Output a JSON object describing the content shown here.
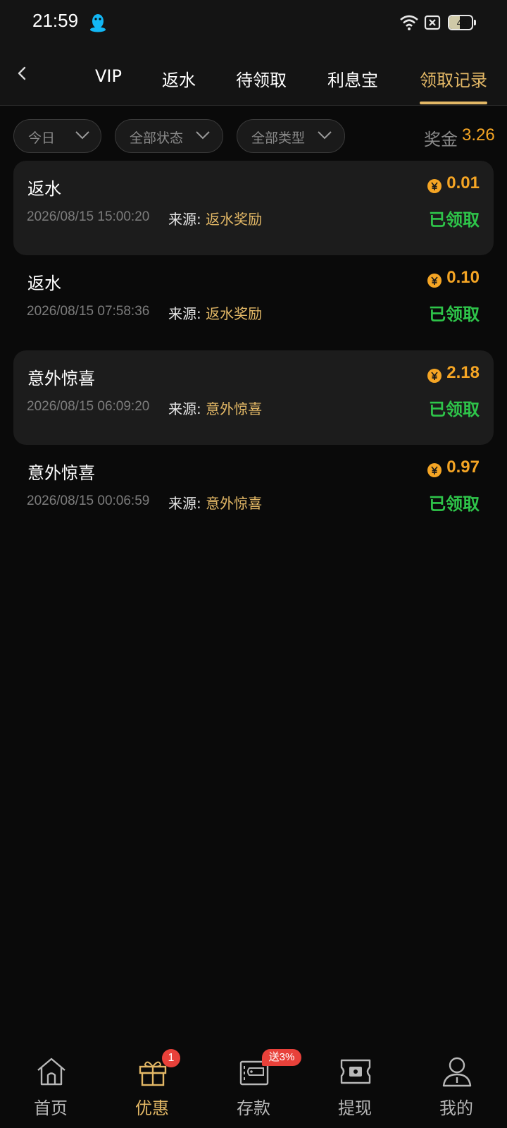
{
  "status_bar": {
    "time": "21:59",
    "battery": "46",
    "battery_level": 0.46,
    "icons": [
      "qq-icon",
      "wifi-icon",
      "no-sim-icon",
      "battery-icon"
    ]
  },
  "header": {
    "back_icon": "chevron-left-icon",
    "tabs": [
      {
        "label": "VIP",
        "active": false
      },
      {
        "label": "返水",
        "active": false
      },
      {
        "label": "待领取",
        "active": false
      },
      {
        "label": "利息宝",
        "active": false
      },
      {
        "label": "领取记录",
        "active": true
      }
    ]
  },
  "filters": {
    "date": "今日",
    "status": "全部状态",
    "type": "全部类型"
  },
  "bonus": {
    "label": "奖金",
    "value": "3.26"
  },
  "source_label": "来源:",
  "records": [
    {
      "title": "返水",
      "time": "2026/08/15 15:00:20",
      "source": "返水奖励",
      "amount": "0.01",
      "status": "已领取"
    },
    {
      "title": "返水",
      "time": "2026/08/15 07:58:36",
      "source": "返水奖励",
      "amount": "0.10",
      "status": "已领取"
    },
    {
      "title": "意外惊喜",
      "time": "2026/08/15 06:09:20",
      "source": "意外惊喜",
      "amount": "2.18",
      "status": "已领取"
    },
    {
      "title": "意外惊喜",
      "time": "2026/08/15 00:06:59",
      "source": "意外惊喜",
      "amount": "0.97",
      "status": "已领取"
    }
  ],
  "bottom_nav": [
    {
      "label": "首页",
      "icon": "home-icon",
      "active": false
    },
    {
      "label": "优惠",
      "icon": "gift-icon",
      "active": true,
      "badge": "1"
    },
    {
      "label": "存款",
      "icon": "wallet-icon",
      "active": false,
      "badge": "送3%"
    },
    {
      "label": "提现",
      "icon": "cash-ticket-icon",
      "active": false
    },
    {
      "label": "我的",
      "icon": "user-icon",
      "active": false
    }
  ],
  "colors": {
    "background": "#0a0a0a",
    "accent_gold": "#e3b866",
    "amount_orange": "#f5a524",
    "status_green": "#2ec54a",
    "badge_red": "#e8413a"
  }
}
